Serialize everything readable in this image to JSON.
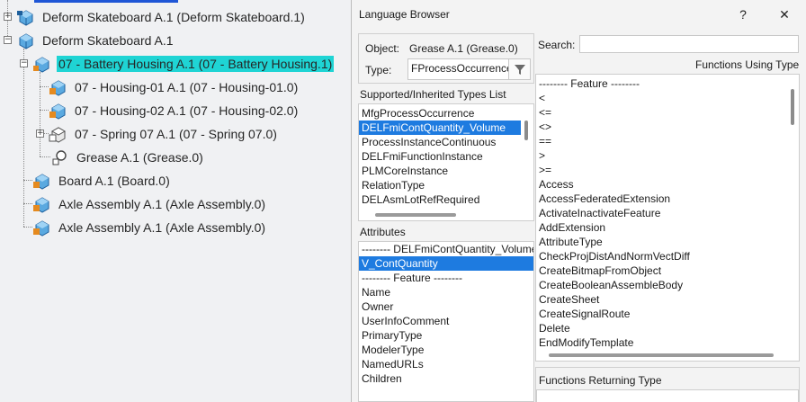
{
  "tree": {
    "nodes": [
      {
        "label": "Deform Skateboard A.1 (Deform Skateboard.1)",
        "highlighted": true
      },
      {
        "label": "Deform Skateboard A.1",
        "highlighted": false
      },
      {
        "label": "07 - Battery Housing A.1 (07 - Battery Housing.1)",
        "highlighted": true
      },
      {
        "label": "07 - Housing-01 A.1 (07 - Housing-01.0)",
        "highlighted": false
      },
      {
        "label": "07 - Housing-02 A.1 (07 - Housing-02.0)",
        "highlighted": false
      },
      {
        "label": "07 - Spring 07 A.1 (07 - Spring 07.0)",
        "highlighted": false
      },
      {
        "label": "Grease A.1 (Grease.0)",
        "highlighted": false
      },
      {
        "label": "Board A.1 (Board.0)",
        "highlighted": false
      },
      {
        "label": "Axle Assembly A.1 (Axle Assembly.0)",
        "highlighted": false
      },
      {
        "label": "Axle Assembly A.1 (Axle Assembly.0)",
        "highlighted": false
      }
    ]
  },
  "dialog": {
    "title": "Language Browser",
    "help": "?",
    "close": "✕",
    "object_label": "Object:",
    "object_value": "Grease A.1 (Grease.0)",
    "type_label": "Type:",
    "type_value": "FProcessOccurrence",
    "search_label": "Search:",
    "search_value": "",
    "functions_using_type_label": "Functions Using Type",
    "supported_types_label": "Supported/Inherited Types List",
    "supported_types": [
      {
        "text": "MfgProcessOccurrence",
        "selected": false
      },
      {
        "text": "DELFmiContQuantity_Volume",
        "selected": true
      },
      {
        "text": "ProcessInstanceContinuous",
        "selected": false
      },
      {
        "text": "DELFmiFunctionInstance",
        "selected": false
      },
      {
        "text": "PLMCoreInstance",
        "selected": false
      },
      {
        "text": "RelationType",
        "selected": false
      },
      {
        "text": "DELAsmLotRefRequired",
        "selected": false
      }
    ],
    "attributes_label": "Attributes",
    "attributes": [
      {
        "text": "-------- DELFmiContQuantity_Volume",
        "selected": false
      },
      {
        "text": "V_ContQuantity",
        "selected": true
      },
      {
        "text": "-------- Feature --------",
        "selected": false
      },
      {
        "text": "Name",
        "selected": false
      },
      {
        "text": "Owner",
        "selected": false
      },
      {
        "text": "UserInfoComment",
        "selected": false
      },
      {
        "text": "PrimaryType",
        "selected": false
      },
      {
        "text": "ModelerType",
        "selected": false
      },
      {
        "text": "NamedURLs",
        "selected": false
      },
      {
        "text": "Children",
        "selected": false
      }
    ],
    "functions": [
      "-------- Feature --------",
      "<",
      "<=",
      "<>",
      "==",
      ">",
      ">=",
      "Access",
      "AccessFederatedExtension",
      "ActivateInactivateFeature",
      "AddExtension",
      "AttributeType",
      "CheckProjDistAndNormVectDiff",
      "CreateBitmapFromObject",
      "CreateBooleanAssembleBody",
      "CreateSheet",
      "CreateSignalRoute",
      "Delete",
      "EndModifyTemplate"
    ],
    "functions_returning_type_label": "Functions Returning Type"
  }
}
